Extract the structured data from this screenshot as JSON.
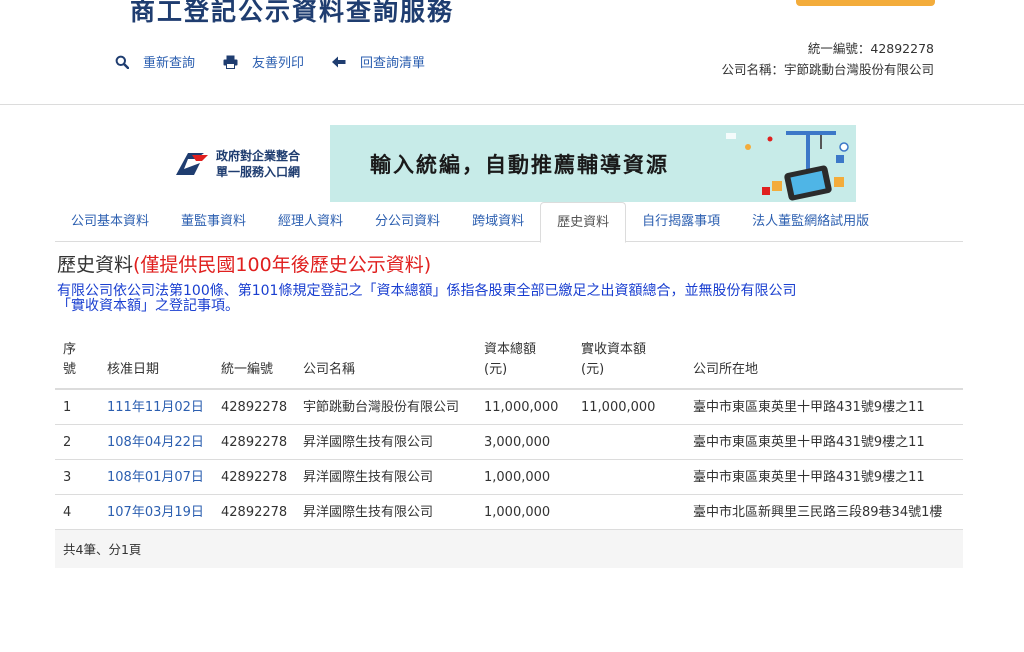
{
  "header": {
    "site_title": "商工登記公示資料查詢服務",
    "toolbar": [
      {
        "icon": "search-icon",
        "label": "重新查詢"
      },
      {
        "icon": "printer-icon",
        "label": "友善列印"
      },
      {
        "icon": "arrow-left-icon",
        "label": "回查詢清單"
      }
    ],
    "company_id_line": "統一編號：42892278",
    "company_name_line": "公司名稱：宇節跳動台灣股份有限公司"
  },
  "banner": {
    "logo_line1": "政府對企業整合",
    "logo_line2": "單一服務入口網",
    "slogan": "輸入統編，自動推薦輔導資源"
  },
  "tabs": [
    {
      "label": "公司基本資料",
      "active": false
    },
    {
      "label": "董監事資料",
      "active": false
    },
    {
      "label": "經理人資料",
      "active": false
    },
    {
      "label": "分公司資料",
      "active": false
    },
    {
      "label": "跨域資料",
      "active": false
    },
    {
      "label": "歷史資料",
      "active": true
    },
    {
      "label": "自行揭露事項",
      "active": false
    },
    {
      "label": "法人董監網絡試用版",
      "active": false
    }
  ],
  "section": {
    "title": "歷史資料",
    "title_note": "(僅提供民國100年後歷史公示資料)",
    "notice_line1": "有限公司依公司法第100條、第101條規定登記之「資本總額」係指各股東全部已繳足之出資額總合，並無股份有限公司",
    "notice_line2": "「實收資本額」之登記事項。"
  },
  "table": {
    "headers": {
      "seq_line1": "序",
      "seq_line2": "號",
      "date": "核准日期",
      "id": "統一編號",
      "name": "公司名稱",
      "capital_line1": "資本總額",
      "capital_line2": "(元)",
      "paid_line1": "實收資本額",
      "paid_line2": "(元)",
      "address": "公司所在地"
    },
    "rows": [
      {
        "seq": "1",
        "date": "111年11月02日",
        "id": "42892278",
        "name": "宇節跳動台灣股份有限公司",
        "capital": "11,000,000",
        "paid": "11,000,000",
        "address": "臺中市東區東英里十甲路431號9樓之11"
      },
      {
        "seq": "2",
        "date": "108年04月22日",
        "id": "42892278",
        "name": "昇洋國際生技有限公司",
        "capital": "3,000,000",
        "paid": "",
        "address": "臺中市東區東英里十甲路431號9樓之11"
      },
      {
        "seq": "3",
        "date": "108年01月07日",
        "id": "42892278",
        "name": "昇洋國際生技有限公司",
        "capital": "1,000,000",
        "paid": "",
        "address": "臺中市東區東英里十甲路431號9樓之11"
      },
      {
        "seq": "4",
        "date": "107年03月19日",
        "id": "42892278",
        "name": "昇洋國際生技有限公司",
        "capital": "1,000,000",
        "paid": "",
        "address": "臺中市北區新興里三民路三段89巷34號1樓"
      }
    ],
    "footer": "共4筆、分1頁"
  },
  "colors": {
    "link": "#2c5fb0",
    "title_navy": "#1f3d70",
    "warning_red": "#e0201f",
    "notice_blue": "#1a3fd0",
    "banner_bg": "#c7ebe8",
    "top_button": "#f3ac3b"
  }
}
